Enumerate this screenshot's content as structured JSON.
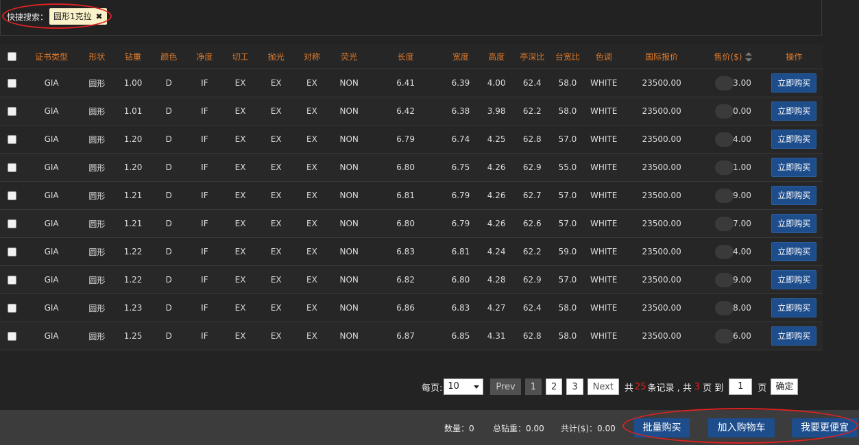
{
  "quick_search": {
    "label": "快捷搜索：",
    "tag": "圆形1克拉",
    "remove_icon": "✖"
  },
  "table": {
    "headers": {
      "cert": "证书类型",
      "shape": "形状",
      "carat": "钻重",
      "color": "颜色",
      "clarity": "净度",
      "cut": "切工",
      "polish": "抛光",
      "symmetry": "对称",
      "fluor": "荧光",
      "length": "长度",
      "width": "宽度",
      "height": "高度",
      "depth": "亭深比",
      "table": "台宽比",
      "tone": "色调",
      "intl_price": "国际报价",
      "price": "售价($)",
      "action": "操作"
    },
    "buy_label": "立即购买",
    "rows": [
      {
        "cert": "GIA",
        "shape": "圆形",
        "carat": "1.00",
        "color": "D",
        "clarity": "IF",
        "cut": "EX",
        "polish": "EX",
        "symmetry": "EX",
        "fluor": "NON",
        "length": "6.41",
        "width": "6.39",
        "height": "4.00",
        "depth": "62.4",
        "table": "58.0",
        "tone": "WHITE",
        "intl": "23500.00",
        "price": "3.00"
      },
      {
        "cert": "GIA",
        "shape": "圆形",
        "carat": "1.01",
        "color": "D",
        "clarity": "IF",
        "cut": "EX",
        "polish": "EX",
        "symmetry": "EX",
        "fluor": "NON",
        "length": "6.42",
        "width": "6.38",
        "height": "3.98",
        "depth": "62.2",
        "table": "58.0",
        "tone": "WHITE",
        "intl": "23500.00",
        "price": "0.00"
      },
      {
        "cert": "GIA",
        "shape": "圆形",
        "carat": "1.20",
        "color": "D",
        "clarity": "IF",
        "cut": "EX",
        "polish": "EX",
        "symmetry": "EX",
        "fluor": "NON",
        "length": "6.79",
        "width": "6.74",
        "height": "4.25",
        "depth": "62.8",
        "table": "57.0",
        "tone": "WHITE",
        "intl": "23500.00",
        "price": "4.00"
      },
      {
        "cert": "GIA",
        "shape": "圆形",
        "carat": "1.20",
        "color": "D",
        "clarity": "IF",
        "cut": "EX",
        "polish": "EX",
        "symmetry": "EX",
        "fluor": "NON",
        "length": "6.80",
        "width": "6.75",
        "height": "4.26",
        "depth": "62.9",
        "table": "55.0",
        "tone": "WHITE",
        "intl": "23500.00",
        "price": "1.00"
      },
      {
        "cert": "GIA",
        "shape": "圆形",
        "carat": "1.21",
        "color": "D",
        "clarity": "IF",
        "cut": "EX",
        "polish": "EX",
        "symmetry": "EX",
        "fluor": "NON",
        "length": "6.81",
        "width": "6.79",
        "height": "4.26",
        "depth": "62.7",
        "table": "57.0",
        "tone": "WHITE",
        "intl": "23500.00",
        "price": "9.00"
      },
      {
        "cert": "GIA",
        "shape": "圆形",
        "carat": "1.21",
        "color": "D",
        "clarity": "IF",
        "cut": "EX",
        "polish": "EX",
        "symmetry": "EX",
        "fluor": "NON",
        "length": "6.80",
        "width": "6.79",
        "height": "4.26",
        "depth": "62.6",
        "table": "57.0",
        "tone": "WHITE",
        "intl": "23500.00",
        "price": "7.00"
      },
      {
        "cert": "GIA",
        "shape": "圆形",
        "carat": "1.22",
        "color": "D",
        "clarity": "IF",
        "cut": "EX",
        "polish": "EX",
        "symmetry": "EX",
        "fluor": "NON",
        "length": "6.83",
        "width": "6.81",
        "height": "4.24",
        "depth": "62.2",
        "table": "59.0",
        "tone": "WHITE",
        "intl": "23500.00",
        "price": "4.00"
      },
      {
        "cert": "GIA",
        "shape": "圆形",
        "carat": "1.22",
        "color": "D",
        "clarity": "IF",
        "cut": "EX",
        "polish": "EX",
        "symmetry": "EX",
        "fluor": "NON",
        "length": "6.82",
        "width": "6.80",
        "height": "4.28",
        "depth": "62.9",
        "table": "57.0",
        "tone": "WHITE",
        "intl": "23500.00",
        "price": "9.00"
      },
      {
        "cert": "GIA",
        "shape": "圆形",
        "carat": "1.23",
        "color": "D",
        "clarity": "IF",
        "cut": "EX",
        "polish": "EX",
        "symmetry": "EX",
        "fluor": "NON",
        "length": "6.86",
        "width": "6.83",
        "height": "4.27",
        "depth": "62.4",
        "table": "58.0",
        "tone": "WHITE",
        "intl": "23500.00",
        "price": "8.00"
      },
      {
        "cert": "GIA",
        "shape": "圆形",
        "carat": "1.25",
        "color": "D",
        "clarity": "IF",
        "cut": "EX",
        "polish": "EX",
        "symmetry": "EX",
        "fluor": "NON",
        "length": "6.87",
        "width": "6.85",
        "height": "4.31",
        "depth": "62.8",
        "table": "58.0",
        "tone": "WHITE",
        "intl": "23500.00",
        "price": "6.00"
      }
    ]
  },
  "pagination": {
    "per_page_label": "每页:",
    "per_page_value": "10",
    "prev": "Prev",
    "pages": [
      "1",
      "2",
      "3"
    ],
    "current_page": "1",
    "next": "Next",
    "total_prefix": "共",
    "total_records": "25",
    "total_mid": "条记录 , 共",
    "total_pages": "3",
    "total_suffix": "页 到",
    "goto_value": "1",
    "page_unit": "页",
    "confirm": "确定"
  },
  "footer": {
    "quantity": "数量：0",
    "total_carat": "总钻重：0.00",
    "total_price": "共计($)：0.00",
    "bulk_buy": "批量购买",
    "add_to_cart": "加入购物车",
    "cheaper": "我要更便宜"
  },
  "colors": {
    "header_text": "#e07a2a",
    "button_blue": "#1e4d8c",
    "highlight_red": "#e02020",
    "annotation_ellipse": "#dd2222"
  }
}
